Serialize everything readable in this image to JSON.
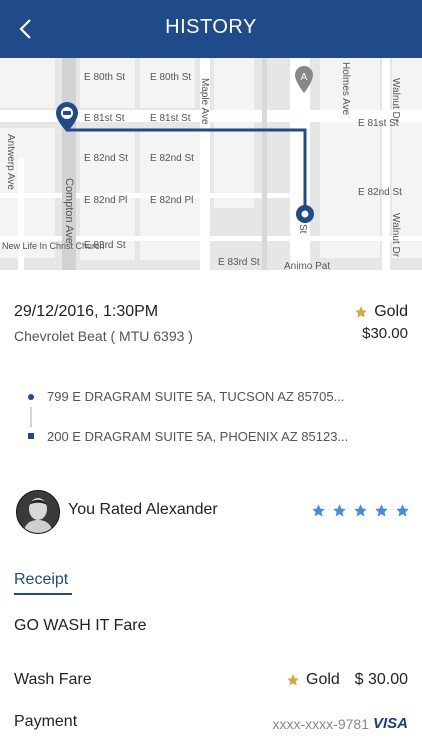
{
  "header": {
    "title": "HISTORY"
  },
  "map": {
    "streets": {
      "e80": "E 80th St",
      "e81": "E 81st St",
      "e82": "E 82nd St",
      "e82pl": "E 82nd Pl",
      "e83": "E 83rd St",
      "maple": "Maple Ave",
      "holmes": "Holmes Ave",
      "walnut": "Walnut Dr",
      "antwerp": "Antwerp Ave",
      "compton": "Compton Ave",
      "st": "St",
      "church": "New Life In Christ Church",
      "animo": "Animo Pat"
    },
    "marker_letter": "A"
  },
  "trip": {
    "datetime": "29/12/2016, 1:30PM",
    "car": "Chevrolet Beat  ( MTU 6393 )",
    "tier": "Gold",
    "price": "$30.00"
  },
  "route": {
    "pickup": "799 E DRAGRAM SUITE 5A,  TUCSON AZ 85705...",
    "dropoff": "200 E DRAGRAM SUITE 5A, PHOENIX AZ 85123..."
  },
  "rating": {
    "text": "You Rated Alexander",
    "stars": 5
  },
  "receipt": {
    "tab": "Receipt",
    "title": "GO WASH IT Fare",
    "fare_label": "Wash Fare",
    "fare_tier": "Gold",
    "fare_amount": "$ 30.00",
    "payment_label": "Payment",
    "card_number": "xxxx-xxxx-9781",
    "card_brand": "VISA"
  },
  "colors": {
    "brand": "#1f4b8a",
    "star_gold": "#d9a640",
    "star_blue": "#3f8fdc"
  }
}
